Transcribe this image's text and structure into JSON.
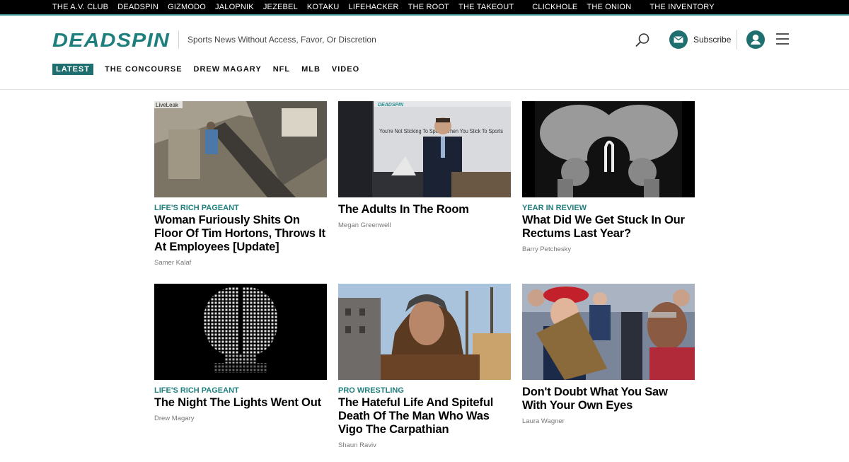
{
  "network": [
    "THE A.V. CLUB",
    "DEADSPIN",
    "GIZMODO",
    "JALOPNIK",
    "JEZEBEL",
    "KOTAKU",
    "LIFEHACKER",
    "THE ROOT",
    "THE TAKEOUT",
    "CLICKHOLE",
    "THE ONION",
    "THE INVENTORY"
  ],
  "header": {
    "logo": "DEADSPIN",
    "tagline": "Sports News Without Access, Favor, Or Discretion",
    "subscribe": "Subscribe",
    "accent": "#1f6f70"
  },
  "nav": [
    "LATEST",
    "THE CONCOURSE",
    "DREW MAGARY",
    "NFL",
    "MLB",
    "VIDEO"
  ],
  "articles": [
    {
      "kicker": "LIFE'S RICH PAGEANT",
      "title": "Woman Furiously Shits On Floor Of Tim Hortons, Throws It At Employees [Update]",
      "author": "Samer Kalaf",
      "thumb_text": "LiveLeak"
    },
    {
      "kicker": "",
      "title": "The Adults In The Room",
      "author": "Megan Greenwell",
      "thumb_text": "You're Not Sticking To Sports When You Stick To Sports",
      "thumb_logo": "DEADSPIN"
    },
    {
      "kicker": "YEAR IN REVIEW",
      "title": "What Did We Get Stuck In Our Rectums Last Year?",
      "author": "Barry Petchesky"
    },
    {
      "kicker": "LIFE'S RICH PAGEANT",
      "title": "The Night The Lights Went Out",
      "author": "Drew Magary"
    },
    {
      "kicker": "PRO WRESTLING",
      "title": "The Hateful Life And Spiteful Death Of The Man Who Was Vigo The Carpathian",
      "author": "Shaun Raviv"
    },
    {
      "kicker": "",
      "title": "Don't Doubt What You Saw With Your Own Eyes",
      "author": "Laura Wagner"
    }
  ]
}
